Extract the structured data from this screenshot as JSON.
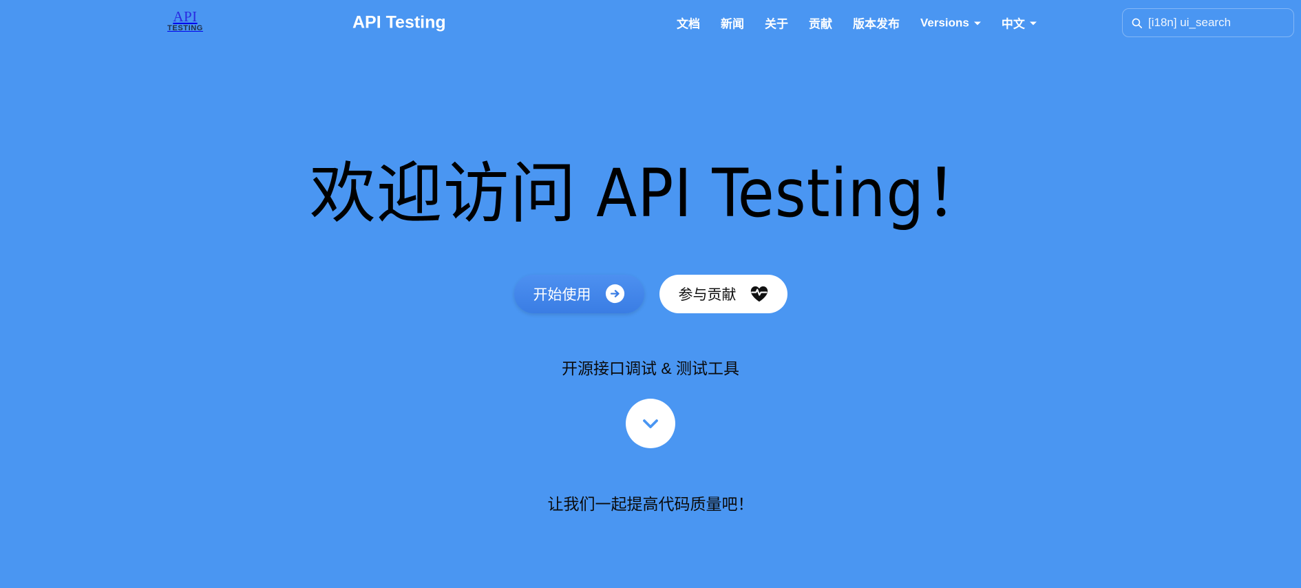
{
  "theme": {
    "background": "#4a96f2",
    "primary_button": "#3a7de4",
    "text_on_hero": "#000000",
    "nav_text": "#ffffff",
    "logo_api_color": "#2a2ae0",
    "logo_testing_color": "#21304a"
  },
  "header": {
    "logo": {
      "api": "API",
      "testing": "TESTING"
    },
    "brand": "API Testing",
    "nav_items": [
      {
        "label": "文档",
        "has_caret": false
      },
      {
        "label": "新闻",
        "has_caret": false
      },
      {
        "label": "关于",
        "has_caret": false
      },
      {
        "label": "贡献",
        "has_caret": false
      },
      {
        "label": "版本发布",
        "has_caret": false
      },
      {
        "label": "Versions",
        "has_caret": true
      },
      {
        "label": "中文",
        "has_caret": true
      }
    ],
    "search": {
      "icon": "search-icon",
      "value": "[i18n] ui_search",
      "placeholder": "[i18n] ui_search"
    }
  },
  "hero": {
    "title": "欢迎访问 API Testing！",
    "primary_button": {
      "label": "开始使用",
      "icon": "arrow-right-circle-icon"
    },
    "secondary_button": {
      "label": "参与贡献",
      "icon": "heart-pulse-icon"
    },
    "tagline": "开源接口调试 & 测试工具",
    "scroll_button_icon": "chevron-down-icon",
    "footnote": "让我们一起提高代码质量吧！"
  }
}
